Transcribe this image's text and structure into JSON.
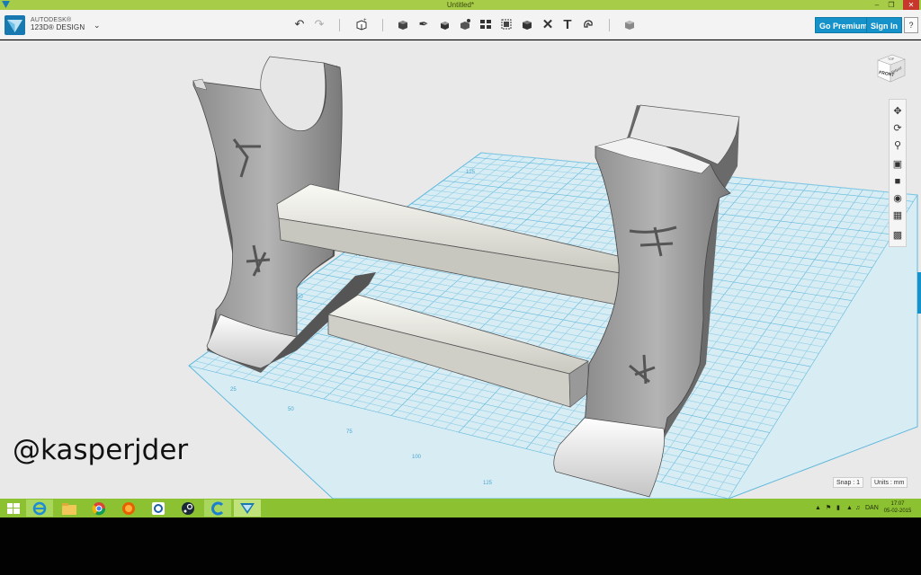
{
  "window": {
    "title": "Untitled*"
  },
  "app": {
    "brand_line1": "AUTODESK®",
    "brand_line2": "123D® DESIGN"
  },
  "toolbar": {
    "tools": [
      "undo-icon",
      "redo-icon",
      "new-primitive-icon",
      "primitives-icon",
      "sketch-icon",
      "construct-icon",
      "modify-icon",
      "pattern-icon",
      "group-icon",
      "combine-icon",
      "measure-icon",
      "text-icon",
      "snap-icon",
      "material-icon"
    ],
    "go_premium": "Go Premium",
    "sign_in": "Sign In",
    "help": "?"
  },
  "viewcube": {
    "front": "FRONT",
    "right": "RIGHT",
    "top": "TOP"
  },
  "navbar": {
    "tools": [
      "pan-icon",
      "orbit-icon",
      "zoom-icon",
      "fit-icon",
      "view-icon",
      "visibility-icon",
      "grid-icon",
      "material-view-icon"
    ]
  },
  "grid": {
    "labels": [
      "25",
      "50",
      "75",
      "100",
      "125",
      "25",
      "50",
      "75",
      "100",
      "125"
    ]
  },
  "status": {
    "snap": "Snap : 1",
    "units": "Units : mm"
  },
  "watermark": "@kasperjder",
  "taskbar": {
    "apps": [
      "start-icon",
      "ie-icon",
      "explorer-icon",
      "chrome-icon",
      "firefox-icon",
      "uplay-icon",
      "steam-icon",
      "ccleaner-icon",
      "123d-design-icon"
    ],
    "language": "DAN",
    "time": "17:07",
    "date": "05-02-2015"
  },
  "colors": {
    "accent": "#1592c9",
    "titlebar": "#a7cc47",
    "taskbar": "#8cc232",
    "grid": "#7fcbe6"
  }
}
